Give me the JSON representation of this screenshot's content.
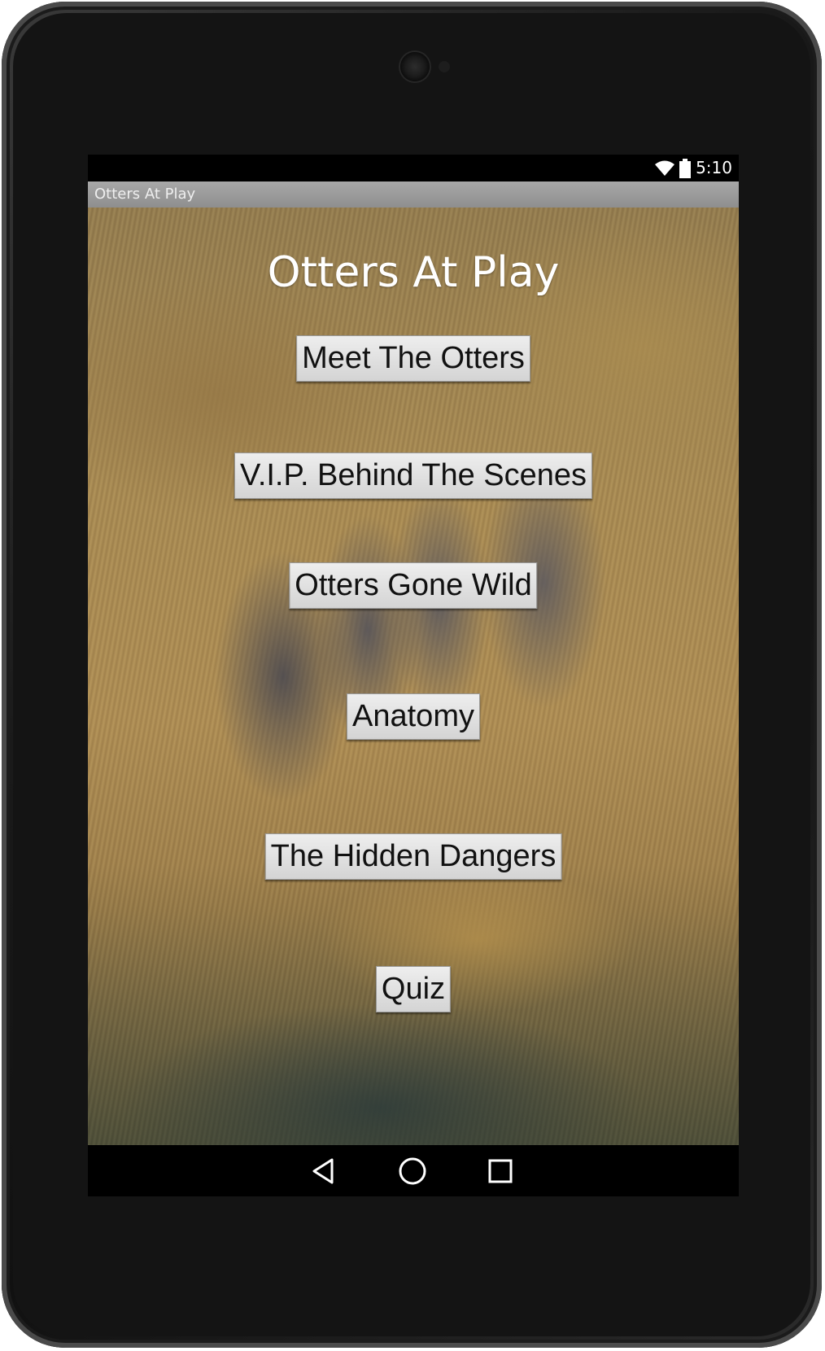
{
  "status_bar": {
    "time": "5:10",
    "icons": [
      "wifi-icon",
      "battery-icon"
    ]
  },
  "app_bar": {
    "title": "Otters At Play"
  },
  "main": {
    "heading": "Otters At Play",
    "buttons": [
      {
        "label": "Meet The Otters"
      },
      {
        "label": "V.I.P. Behind The Scenes"
      },
      {
        "label": "Otters Gone Wild"
      },
      {
        "label": "Anatomy"
      },
      {
        "label": "The Hidden Dangers"
      },
      {
        "label": "Quiz"
      }
    ]
  },
  "nav_bar": {
    "icons": [
      "back-icon",
      "home-icon",
      "recents-icon"
    ]
  }
}
